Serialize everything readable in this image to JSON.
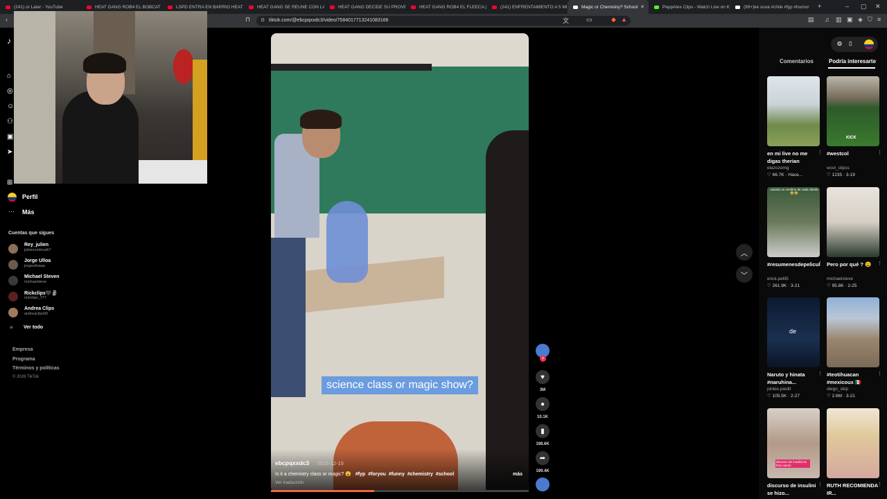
{
  "tabs": [
    {
      "label": "(241) or Later - YouTube",
      "fav": "#f03"
    },
    {
      "label": "HEAT GANG ROB4 EL BOBCAT | DO",
      "fav": "#f03"
    },
    {
      "label": "LSPD ENTRA EN BARRIO HEATGAN",
      "fav": "#f03"
    },
    {
      "label": "HEAT GANG SE REUNE CON LAS T",
      "fav": "#f03"
    },
    {
      "label": "HEAT GANG DECIDE SU PROVEEDO",
      "fav": "#f03"
    },
    {
      "label": "HEAT GANG ROB4 EL FLEECA | BAN",
      "fav": "#f03"
    },
    {
      "label": "(241) ENFRENTAMIENTO A 5 MIN",
      "fav": "#f03"
    },
    {
      "label": "Magic or Chemistry? School",
      "fav": "#fff",
      "active": true
    },
    {
      "label": "PeppAlex Clips - Watch Live on Ki",
      "fav": "#53fc18"
    },
    {
      "label": "(99+)ke xuxa #chile #fyp #humor",
      "fav": "#fff"
    }
  ],
  "url": "tiktok.com/@ebcpqxxdc3/video/7584017713241083166",
  "sidebar": {
    "profile_label": "Perfil",
    "more_label": "Más",
    "following_title": "Cuentas que sigues",
    "following": [
      {
        "name": "Rey_julien",
        "handle": "juliancordova67"
      },
      {
        "name": "Jorge Ulloa",
        "handle": "jorgeulloaaa"
      },
      {
        "name": "Michael Steven",
        "handle": "michaelsteve"
      },
      {
        "name": "Rickclips🖤🗿",
        "handle": "rickclips_777"
      },
      {
        "name": "Andrea Clips",
        "handle": "andreaclips00"
      }
    ],
    "see_all": "Ver todo",
    "footer": [
      "Empresa",
      "Programa",
      "Términos y políticas"
    ],
    "copyright": "© 2026 TikTok"
  },
  "video": {
    "caption_overlay": "science class or magic show?",
    "author": "ebcpqxxdc3",
    "date": "· 2025-12-15",
    "description": "Is it a chemistry class or magic? 😮",
    "hashtags": [
      "#fyp",
      "#foryou",
      "#funny",
      "#chemistry",
      "#school"
    ],
    "translate": "Ver traducción",
    "more": "más",
    "progress": 0.4
  },
  "actions": {
    "likes": "3M",
    "comments": "10.1K",
    "saves": "198.6K",
    "shares": "199.4K"
  },
  "right_panel": {
    "tab_comments": "Comentarios",
    "tab_suggested": "Podría interesarte",
    "cards": [
      {
        "title": "en mi live no me digas therian",
        "user": "elazozomg",
        "stat": "♡ 66.7K · Hace..."
      },
      {
        "title": "#westcol",
        "user": "wcol_clipss",
        "stat": "♡ 1235 · 3-19"
      },
      {
        "title": "#resumenesdepeliculas...",
        "user": "erick.pelli5",
        "stat": "♡ 261.9K · 3-21"
      },
      {
        "title": "Pero por qué ? 😩",
        "user": "michaelsteve",
        "stat": "♡ 95.8K · 2-25"
      },
      {
        "title": "Naruto y hinata #naruhina...",
        "user": "pinkie.piedit",
        "stat": "♡ 105.5K · 2-27"
      },
      {
        "title": "#teotihuacan #mexicoux 🇲🇽",
        "user": "diego_sklp",
        "stat": "♡ 2.6M · 3-21"
      },
      {
        "title": "discurso de insulini se hizo...",
        "user": "",
        "stat": ""
      },
      {
        "title": "RUTH RECOMIENDA IR...",
        "user": "",
        "stat": ""
      }
    ],
    "thumb_texts": [
      "KICK",
      "de",
      "usando un centimo de cada cliente 😂😂",
      "discurso de insulini se hizo canon"
    ]
  }
}
